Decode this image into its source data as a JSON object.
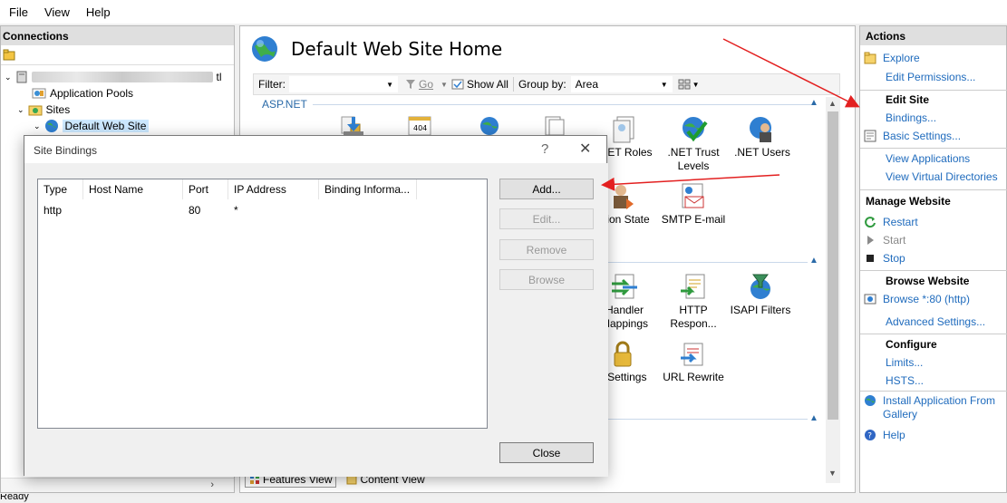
{
  "menu": {
    "items": [
      "File",
      "View",
      "Help"
    ]
  },
  "connections": {
    "header": "Connections",
    "tree": {
      "server_name": "",
      "server_suffix": "tl",
      "app_pools": "Application Pools",
      "sites": "Sites",
      "site": "Default Web Site"
    }
  },
  "center": {
    "title": "Default Web Site Home",
    "filter_label": "Filter:",
    "go_label": "Go",
    "show_all": "Show All",
    "group_by_label": "Group by:",
    "group_by_value": "Area",
    "section_aspnet": "ASP.NET",
    "features": {
      "net_roles": ".NET Roles",
      "net_trust_levels": ".NET Trust Levels",
      "net_users": ".NET Users",
      "session_state": "ssion State",
      "smtp_email": "SMTP E-mail",
      "handler_mappings": "Handler Mappings",
      "http_response": "HTTP Respon...",
      "isapi_filters": "ISAPI Filters",
      "ssl_settings": "L Settings",
      "url_rewrite": "URL Rewrite"
    },
    "tabs": {
      "features_view": "Features View",
      "content_view": "Content View"
    }
  },
  "actions": {
    "header": "Actions",
    "explore": "Explore",
    "edit_permissions": "Edit Permissions...",
    "edit_site_head": "Edit Site",
    "bindings": "Bindings...",
    "basic_settings": "Basic Settings...",
    "view_applications": "View Applications",
    "view_virtual_directories": "View Virtual Directories",
    "manage_website_head": "Manage Website",
    "restart": "Restart",
    "start": "Start",
    "stop": "Stop",
    "browse_website_head": "Browse Website",
    "browse_80": "Browse *:80 (http)",
    "advanced_settings": "Advanced Settings...",
    "configure_head": "Configure",
    "limits": "Limits...",
    "hsts": "HSTS...",
    "install_app_line1": "Install Application From",
    "install_app_line2": "Gallery",
    "help": "Help"
  },
  "status": {
    "text": "Ready"
  },
  "dialog": {
    "title": "Site Bindings",
    "help_glyph": "?",
    "close_glyph": "✕",
    "columns": [
      "Type",
      "Host Name",
      "Port",
      "IP Address",
      "Binding Informa..."
    ],
    "rows": [
      {
        "type": "http",
        "host": "",
        "port": "80",
        "ip": "*",
        "info": ""
      }
    ],
    "buttons": {
      "add": "Add...",
      "edit": "Edit...",
      "remove": "Remove",
      "browse": "Browse",
      "close": "Close"
    }
  },
  "colors": {
    "link": "#1f6bbd",
    "annotation_arrow": "#e32020",
    "section": "#2a6aa8"
  }
}
